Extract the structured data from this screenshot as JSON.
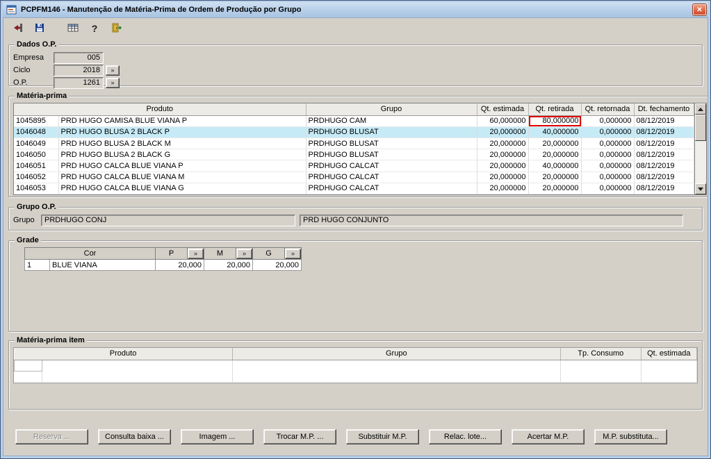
{
  "window": {
    "title": "PCPFM146 - Manutenção de Matéria-Prima de Ordem de Produção por Grupo",
    "close_glyph": "✕"
  },
  "colors": {
    "face": "#d4d0c8",
    "frame": "#b9cfe8",
    "titlebar_light": "#cfe0f2",
    "titlebar_dark": "#a9c4e2",
    "selection": "#c6ebf7",
    "highlight": "#e00000"
  },
  "toolbar": {
    "items": [
      {
        "name": "post-exit-icon"
      },
      {
        "name": "save-icon"
      },
      {
        "name": "grid-icon"
      },
      {
        "name": "help-icon",
        "glyph": "?"
      },
      {
        "name": "exit-door-icon"
      }
    ]
  },
  "dados_op": {
    "legend": "Dados O.P.",
    "lookup_glyph": "»",
    "fields": [
      {
        "label": "Empresa",
        "value": "005",
        "has_button": false
      },
      {
        "label": "Ciclo",
        "value": "2018",
        "has_button": true
      },
      {
        "label": "O.P.",
        "value": "1261",
        "has_button": true
      }
    ]
  },
  "materia_prima": {
    "legend": "Matéria-prima",
    "columns": {
      "produto": "Produto",
      "grupo": "Grupo",
      "qt_estimada": "Qt. estimada",
      "qt_retirada": "Qt. retirada",
      "qt_retornada": "Qt. retornada",
      "dt_fechamento": "Dt. fechamento"
    },
    "selected_row_index": 1,
    "highlight": {
      "row": 0,
      "column": "qt_retirada",
      "color": "#e00000"
    },
    "rows": [
      {
        "codigo": "1045895",
        "produto": "PRD HUGO CAMISA BLUE VIANA P",
        "grupo": "PRDHUGO CAM",
        "qt_estimada": "60,000000",
        "qt_retirada": "80,000000",
        "qt_retornada": "0,000000",
        "dt_fechamento": "08/12/2019"
      },
      {
        "codigo": "1046048",
        "produto": "PRD HUGO BLUSA 2 BLACK P",
        "grupo": "PRDHUGO BLUSAT",
        "qt_estimada": "20,000000",
        "qt_retirada": "40,000000",
        "qt_retornada": "0,000000",
        "dt_fechamento": "08/12/2019"
      },
      {
        "codigo": "1046049",
        "produto": "PRD HUGO BLUSA 2 BLACK M",
        "grupo": "PRDHUGO BLUSAT",
        "qt_estimada": "20,000000",
        "qt_retirada": "20,000000",
        "qt_retornada": "0,000000",
        "dt_fechamento": "08/12/2019"
      },
      {
        "codigo": "1046050",
        "produto": "PRD HUGO BLUSA 2 BLACK G",
        "grupo": "PRDHUGO BLUSAT",
        "qt_estimada": "20,000000",
        "qt_retirada": "20,000000",
        "qt_retornada": "0,000000",
        "dt_fechamento": "08/12/2019"
      },
      {
        "codigo": "1046051",
        "produto": "PRD HUGO CALCA BLUE VIANA P",
        "grupo": "PRDHUGO CALCAT",
        "qt_estimada": "20,000000",
        "qt_retirada": "40,000000",
        "qt_retornada": "0,000000",
        "dt_fechamento": "08/12/2019"
      },
      {
        "codigo": "1046052",
        "produto": "PRD HUGO CALCA BLUE VIANA M",
        "grupo": "PRDHUGO CALCAT",
        "qt_estimada": "20,000000",
        "qt_retirada": "20,000000",
        "qt_retornada": "0,000000",
        "dt_fechamento": "08/12/2019"
      },
      {
        "codigo": "1046053",
        "produto": "PRD HUGO CALCA BLUE VIANA G",
        "grupo": "PRDHUGO CALCAT",
        "qt_estimada": "20,000000",
        "qt_retirada": "20,000000",
        "qt_retornada": "0,000000",
        "dt_fechamento": "08/12/2019"
      }
    ]
  },
  "grupo_op": {
    "legend": "Grupo O.P.",
    "label": "Grupo",
    "codigo": "PRDHUGO CONJ",
    "descricao": "PRD HUGO CONJUNTO"
  },
  "grade": {
    "legend": "Grade",
    "cor_header": "Cor",
    "lookup_glyph": "»",
    "size_columns": [
      "P",
      "M",
      "G"
    ],
    "rows": [
      {
        "seq": "1",
        "cor": "BLUE VIANA",
        "values": [
          "20,000",
          "20,000",
          "20,000"
        ]
      }
    ]
  },
  "materia_prima_item": {
    "legend": "Matéria-prima item",
    "columns": {
      "produto": "Produto",
      "grupo": "Grupo",
      "tp_consumo": "Tp. Consumo",
      "qt_estimada": "Qt. estimada"
    }
  },
  "footer": {
    "buttons": [
      {
        "label": "Reserva ...",
        "disabled": true
      },
      {
        "label": "Consulta baixa ...",
        "disabled": false
      },
      {
        "label": "Imagem ...",
        "disabled": false
      },
      {
        "label": "Trocar M.P. ...",
        "disabled": false
      },
      {
        "label": "Substituir M.P.",
        "disabled": false
      },
      {
        "label": "Relac. lote...",
        "disabled": false
      },
      {
        "label": "Acertar M.P.",
        "disabled": false
      },
      {
        "label": "M.P. substituta...",
        "disabled": false
      }
    ]
  }
}
